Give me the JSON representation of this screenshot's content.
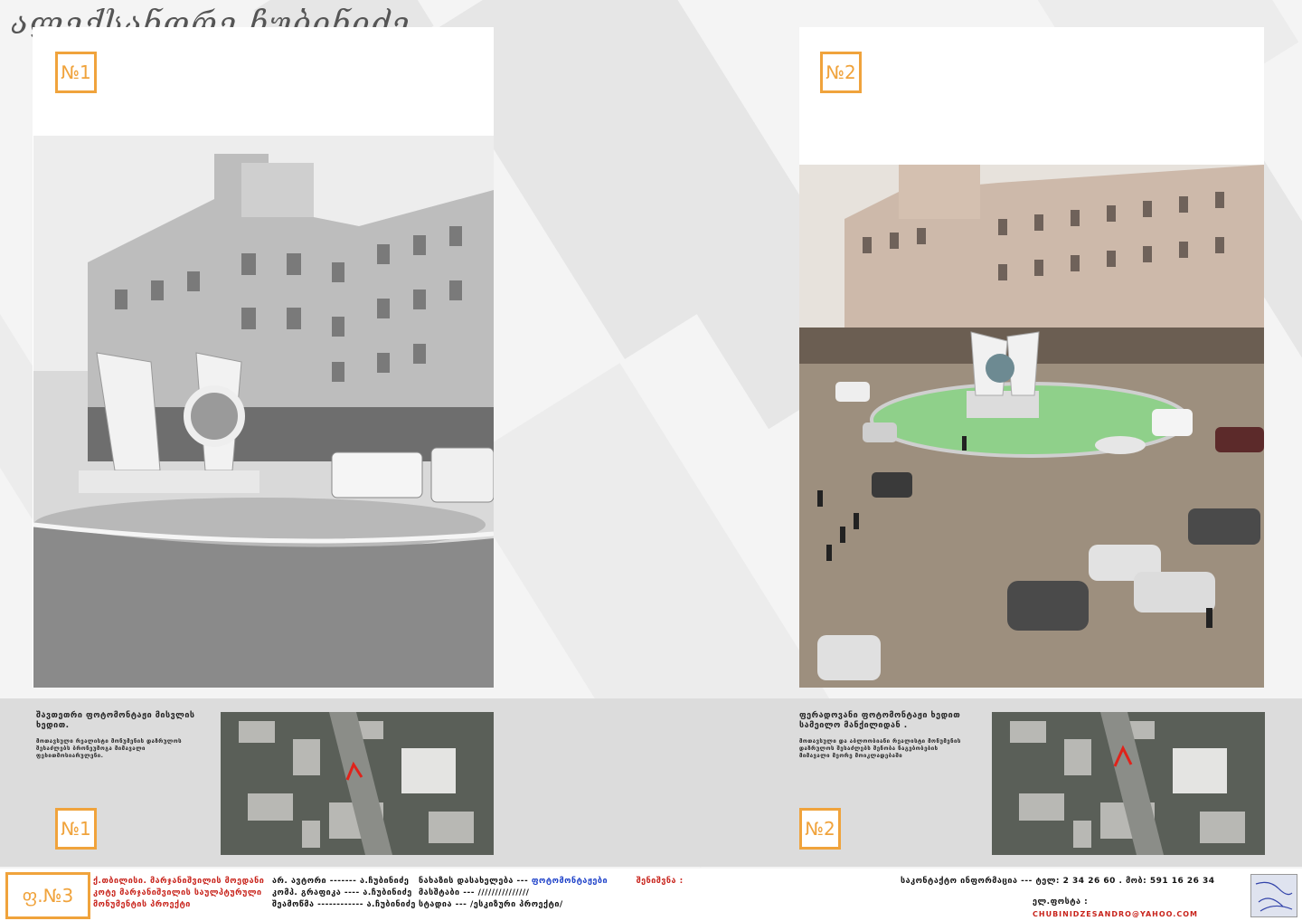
{
  "title": "ალექსანდრე ჩუბინიძე",
  "badge1": "№1",
  "badge2": "№2",
  "colors": {
    "accent": "#f0a33c",
    "red": "#c8231b",
    "blue": "#1b3fc8"
  },
  "desc1": {
    "title": "შავთეთრი ფოტომონტაჟი მისვლის ხედით.",
    "sub": "მოთავსული რეალისტი მონუმენის დაზრულოს შესაძლებს ბრონეუმოგა მიმავალი ფეხითმოსიარულენი."
  },
  "desc2": {
    "title": "ფერადოვანი ფოტომონტაჟი ხედით სამეილო მანქილიდან .",
    "sub": "მოთავსული და აბლოობიანი რეალისტი მონუმენის დაზრულოს შესაძლებს შენობა ნაგებობების მიმავალი მეორე მოიკლადებაში"
  },
  "sheet": "ფ.№3",
  "footer": {
    "project_line1": "ქ.თბილისი. მარჯანიშვილის მოედანი",
    "project_line2": "კოტე მარჯანიშვილის საულპტურული",
    "project_line3": "მონუმენტის პროექტი",
    "author_line1": "არ. ავტორი ------- ა.ჩუბინიძე",
    "author_line2": "კომპ. გრაფიკა ---- ა.ჩუბინიძე",
    "author_line3": "შეამოწმა ------------ ა.ჩუბინიძე",
    "sheet_label": "ნახაზის დასახელება ---",
    "sheet_value": "ფოტომონტაჟები",
    "note": "შენიშვნა :",
    "scale_line": "მასშტაბი --- ///////////////",
    "stage_line": "სტადია ---  /ესკიზური პროექტი/",
    "contact_line": "საკონტაქტო ინფორმაცია  --- ტელ: 2 34 26 60 . მობ: 591 16 26 34",
    "email_label": "ელ.ფოსტა :",
    "email_value": "chubinidzesandro@yahoo.com"
  }
}
